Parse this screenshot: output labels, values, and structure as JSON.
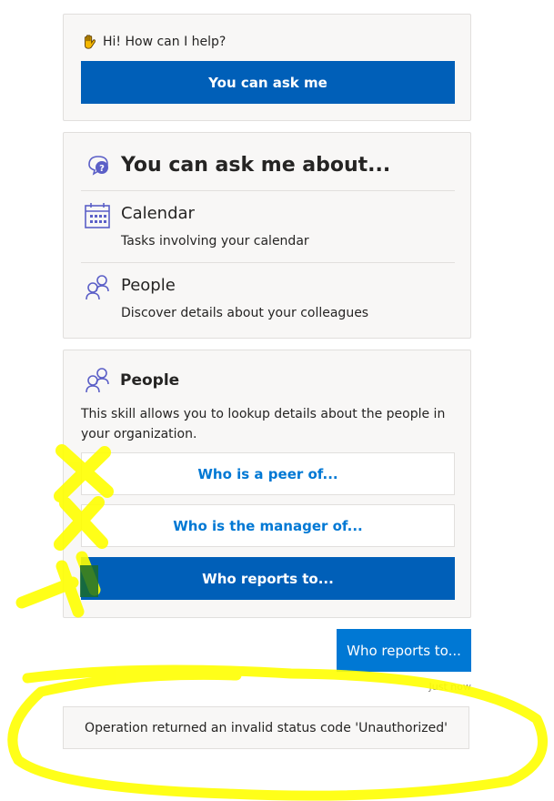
{
  "greeting": {
    "text": "Hi! How can I help?",
    "button_label": "You can ask me"
  },
  "about": {
    "title": "You can ask me about...",
    "skills": [
      {
        "title": "Calendar",
        "description": "Tasks involving your calendar",
        "icon": "calendar-icon"
      },
      {
        "title": "People",
        "description": "Discover details about your colleagues",
        "icon": "people-icon"
      }
    ]
  },
  "people_card": {
    "title": "People",
    "description": "This skill allows you to lookup details about the people in your organization.",
    "actions": [
      {
        "label": "Who is a peer of...",
        "selected": false
      },
      {
        "label": "Who is the manager of...",
        "selected": false
      },
      {
        "label": "Who reports to...",
        "selected": true
      }
    ]
  },
  "conversation": {
    "user_message": "Who reports to...",
    "timestamp": "Just now",
    "bot_error": "Operation returned an invalid status code 'Unauthorized'"
  },
  "colors": {
    "primary": "#005fb8",
    "user_bubble": "#0078d4",
    "link": "#0078d4",
    "card_bg": "#f8f7f6",
    "annotation": "#ffff00"
  }
}
